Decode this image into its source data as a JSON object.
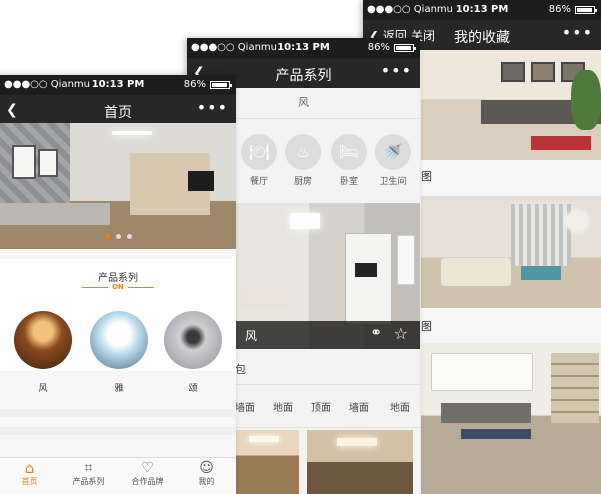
{
  "status": {
    "carrier": "●●●○○ Qianmu",
    "time": "10:13 PM",
    "battery": "86%",
    "battery_level": 0.86
  },
  "screen_favorites": {
    "back_label": "返回",
    "close_label": "关闭",
    "title": "我的收藏",
    "captions": [
      "图",
      "图"
    ]
  },
  "screen_series": {
    "title": "产品系列",
    "style_label": "风",
    "categories": [
      "餐厅",
      "厨房",
      "卧室",
      "卫生间"
    ],
    "image_caption": "风",
    "section_text": "包",
    "filters": [
      "墙面",
      "地面",
      "顶面",
      "墙面",
      "地面"
    ]
  },
  "screen_home": {
    "title": "首页",
    "section_title": "产品系列",
    "section_badge": "ON",
    "styles": [
      "风",
      "雅",
      "颂"
    ],
    "tabs": [
      "首页",
      "产品系列",
      "合作品牌",
      "我的"
    ]
  },
  "colors": {
    "accent": "#f07d18",
    "navbar": "#272727",
    "statusbar": "#1d1d1d"
  }
}
